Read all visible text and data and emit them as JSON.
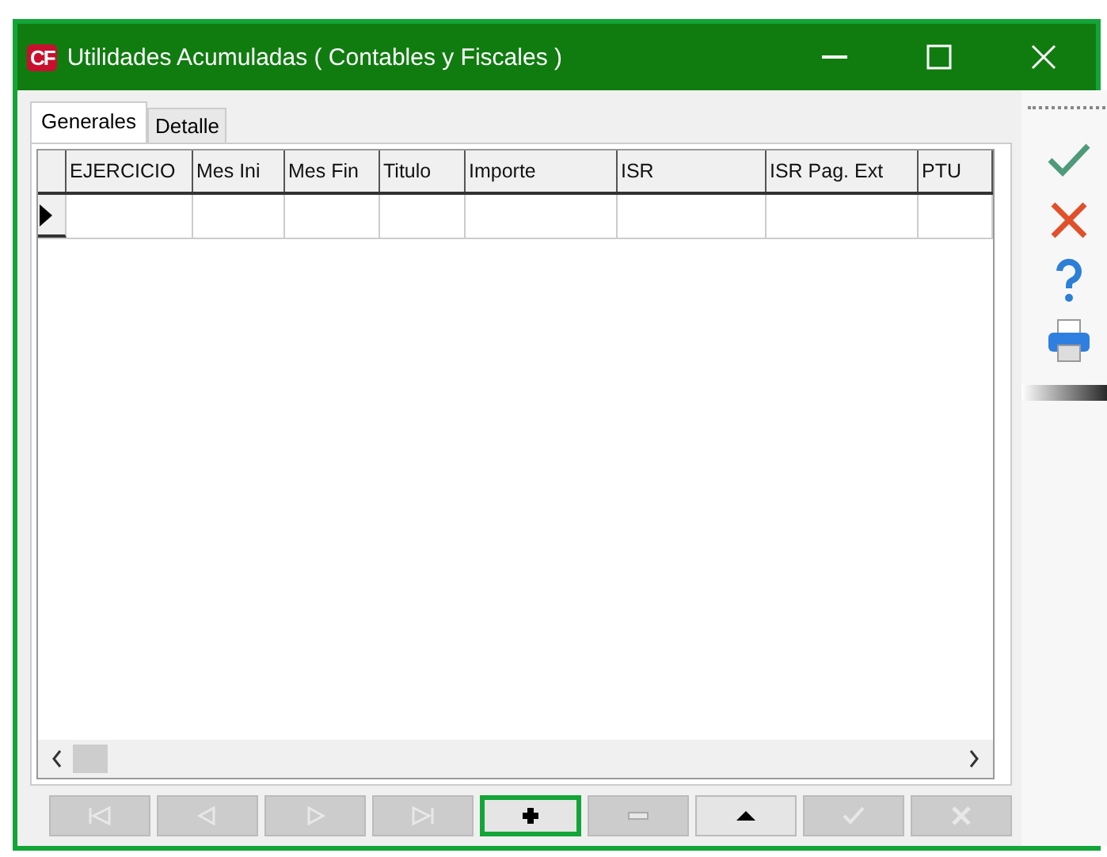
{
  "window": {
    "title": "Utilidades Acumuladas ( Contables y Fiscales )",
    "app_logo": "CF"
  },
  "tabs": [
    {
      "label": "Generales",
      "selected": true
    },
    {
      "label": "Detalle",
      "selected": false
    }
  ],
  "table": {
    "columns": [
      "EJERCICIO",
      "Mes Ini",
      "Mes Fin",
      "Titulo",
      "Importe",
      "ISR",
      "ISR Pag. Ext",
      "PTU"
    ]
  },
  "toolbar": [
    {
      "kind": "accept"
    },
    {
      "kind": "cancel"
    },
    {
      "kind": "help"
    },
    {
      "kind": "print"
    }
  ],
  "navigator": [
    {
      "kind": "first",
      "disabled": true,
      "highlighted": false
    },
    {
      "kind": "prior",
      "disabled": true,
      "highlighted": false
    },
    {
      "kind": "next",
      "disabled": true,
      "highlighted": false
    },
    {
      "kind": "last",
      "disabled": true,
      "highlighted": false
    },
    {
      "kind": "insert",
      "disabled": false,
      "highlighted": true
    },
    {
      "kind": "delete",
      "disabled": true,
      "highlighted": false
    },
    {
      "kind": "edit",
      "disabled": false,
      "highlighted": false
    },
    {
      "kind": "post",
      "disabled": true,
      "highlighted": false
    },
    {
      "kind": "cancel",
      "disabled": true,
      "highlighted": false
    }
  ]
}
